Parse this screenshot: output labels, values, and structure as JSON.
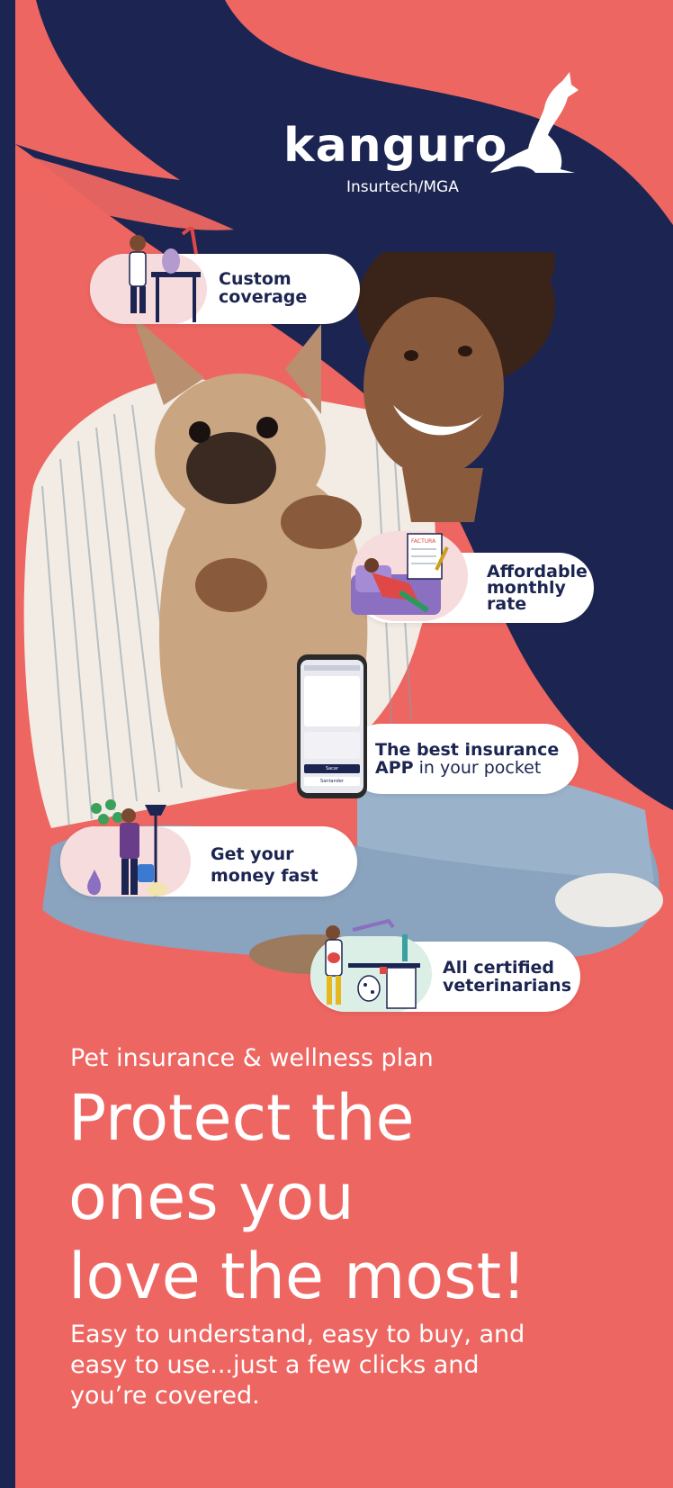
{
  "brand": {
    "name": "kanguro",
    "tagline": "Insurtech/MGA",
    "logo_icon": "kangaroo-icon"
  },
  "features": [
    {
      "line1": "Custom",
      "line2": "coverage",
      "icon": "vet-examining-cat-illustration"
    },
    {
      "line1": "Affordable",
      "line2": "monthly",
      "line3": "rate",
      "icon": "person-with-invoice-illustration"
    },
    {
      "line1_bold": "The best insurance",
      "line2_bold": "APP",
      "line2_rest": " in your pocket",
      "icon": "phone-app-illustration"
    },
    {
      "line1": "Get your",
      "line2": "money fast",
      "icon": "person-with-money-and-pets-illustration"
    },
    {
      "line1": "All certified",
      "line2": "veterinarians",
      "icon": "veterinarian-with-dog-illustration"
    }
  ],
  "phone_screen": {
    "button_label": "Sacar",
    "secondary_label": "Santander"
  },
  "invoice_label": "FACTURA",
  "hero": {
    "kicker": "Pet insurance & wellness plan",
    "headline_line1": "Protect the",
    "headline_line2": "ones you",
    "headline_line3": "love the most!",
    "body_line1": "Easy to understand, easy to buy, and",
    "body_line2": "easy to use...just a few clicks and",
    "body_line3": "you’re covered."
  },
  "colors": {
    "coral": "#ee6661",
    "navy": "#1c2551",
    "white": "#ffffff"
  }
}
